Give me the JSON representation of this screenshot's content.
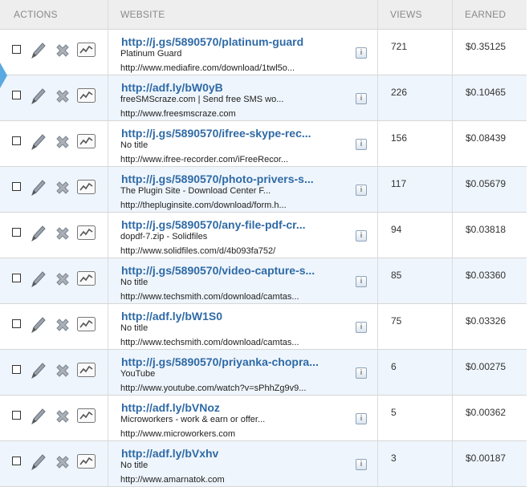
{
  "headers": {
    "actions": "ACTIONS",
    "website": "WEBSITE",
    "views": "VIEWS",
    "earned": "EARNED"
  },
  "info_glyph": "i",
  "colors": {
    "link": "#2f6aa6",
    "alt_row": "#eef5fc",
    "header_bg": "#eeeeee",
    "pointer": "#5aa9e0"
  },
  "icons": [
    "checkbox",
    "pencil-icon",
    "delete-icon",
    "stats-icon",
    "info-icon"
  ],
  "rows": [
    {
      "link": "http://j.gs/5890570/platinum-guard",
      "title": "Platinum Guard",
      "url": "http://www.mediafire.com/download/1twl5o...",
      "views": "721",
      "earned": "$0.35125"
    },
    {
      "link": "http://adf.ly/bW0yB",
      "title": "freeSMScraze.com | Send free SMS wo...",
      "url": "http://www.freesmscraze.com",
      "views": "226",
      "earned": "$0.10465"
    },
    {
      "link": "http://j.gs/5890570/ifree-skype-rec...",
      "title": "No title",
      "url": "http://www.ifree-recorder.com/iFreeRecor...",
      "views": "156",
      "earned": "$0.08439"
    },
    {
      "link": "http://j.gs/5890570/photo-privers-s...",
      "title": "The Plugin Site - Download Center F...",
      "url": "http://thepluginsite.com/download/form.h...",
      "views": "117",
      "earned": "$0.05679"
    },
    {
      "link": "http://j.gs/5890570/any-file-pdf-cr...",
      "title": "dopdf-7.zip - Solidfiles",
      "url": "http://www.solidfiles.com/d/4b093fa752/",
      "views": "94",
      "earned": "$0.03818"
    },
    {
      "link": "http://j.gs/5890570/video-capture-s...",
      "title": "No title",
      "url": "http://www.techsmith.com/download/camtas...",
      "views": "85",
      "earned": "$0.03360"
    },
    {
      "link": "http://adf.ly/bW1S0",
      "title": "No title",
      "url": "http://www.techsmith.com/download/camtas...",
      "views": "75",
      "earned": "$0.03326"
    },
    {
      "link": "http://j.gs/5890570/priyanka-chopra...",
      "title": "YouTube",
      "url": "http://www.youtube.com/watch?v=sPhhZg9v9...",
      "views": "6",
      "earned": "$0.00275"
    },
    {
      "link": "http://adf.ly/bVNoz",
      "title": "Microworkers - work & earn or offer...",
      "url": "http://www.microworkers.com",
      "views": "5",
      "earned": "$0.00362"
    },
    {
      "link": "http://adf.ly/bVxhv",
      "title": "No title",
      "url": "http://www.amarnatok.com",
      "views": "3",
      "earned": "$0.00187"
    }
  ]
}
